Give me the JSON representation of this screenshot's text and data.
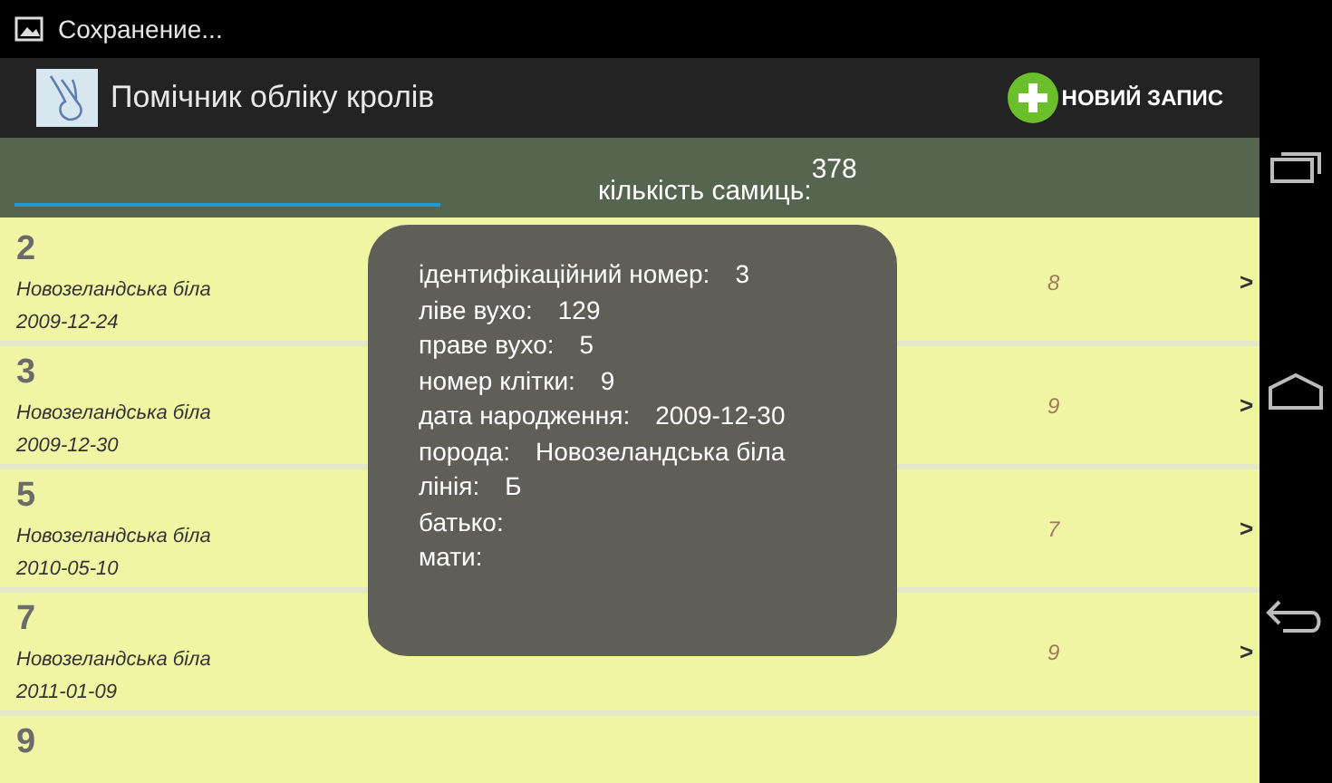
{
  "status_bar": {
    "notification": "Сохранение..."
  },
  "action_bar": {
    "title": "Помічник обліку кролів",
    "action": "НОВИЙ ЗАПИС"
  },
  "filter_bar": {
    "label": "кількість самиць:",
    "count": "378"
  },
  "rows": [
    {
      "number": "2",
      "breed": "Новозеландська біла",
      "date": "2009-12-24",
      "value": "8",
      "arrow": ">"
    },
    {
      "number": "3",
      "breed": "Новозеландська біла",
      "date": "2009-12-30",
      "value": "9",
      "arrow": ">"
    },
    {
      "number": "5",
      "breed": "Новозеландська біла",
      "date": "2010-05-10",
      "value": "7",
      "arrow": ">"
    },
    {
      "number": "7",
      "breed": "Новозеландська біла",
      "date": "2011-01-09",
      "value": "9",
      "arrow": ">"
    },
    {
      "number": "9"
    }
  ],
  "toast": {
    "lines": [
      {
        "label": "ідентифікаційний номер:",
        "value": "3"
      },
      {
        "label": "ліве вухо:",
        "value": "129"
      },
      {
        "label": "праве вухо:",
        "value": "5"
      },
      {
        "label": "номер клітки:",
        "value": "9"
      },
      {
        "label": "дата народження:",
        "value": "2009-12-30"
      },
      {
        "label": "порода:",
        "value": "Новозеландська біла"
      },
      {
        "label": "лінія:",
        "value": "Б"
      },
      {
        "label": "батько:"
      },
      {
        "label": "мати:"
      }
    ]
  }
}
